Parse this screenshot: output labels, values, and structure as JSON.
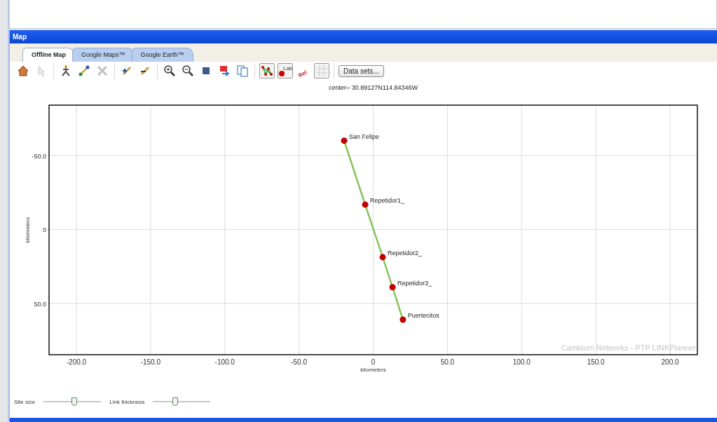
{
  "panel": {
    "title": "Map"
  },
  "tabs": [
    {
      "label": "Offline Map",
      "selected": true
    },
    {
      "label": "Google Maps™",
      "selected": false
    },
    {
      "label": "Google Earth™",
      "selected": false
    }
  ],
  "toolbar": {
    "groups": [
      [
        {
          "kind": "home",
          "pressed": false,
          "disabled": false
        },
        {
          "kind": "pointer",
          "pressed": false,
          "disabled": true
        }
      ],
      [
        {
          "kind": "site",
          "pressed": false,
          "disabled": false
        },
        {
          "kind": "link",
          "pressed": false,
          "disabled": false
        },
        {
          "kind": "delete",
          "pressed": false,
          "disabled": true
        }
      ],
      [
        {
          "kind": "add-brush",
          "pressed": false,
          "disabled": false
        },
        {
          "kind": "remove-brush",
          "pressed": false,
          "disabled": false
        }
      ],
      [
        {
          "kind": "zoom-in",
          "pressed": false,
          "disabled": false
        },
        {
          "kind": "zoom-out",
          "pressed": false,
          "disabled": false
        },
        {
          "kind": "fit",
          "pressed": false,
          "disabled": false
        },
        {
          "kind": "export",
          "pressed": false,
          "disabled": false
        },
        {
          "kind": "copy",
          "pressed": false,
          "disabled": false
        }
      ],
      [
        {
          "kind": "network",
          "pressed": true,
          "disabled": false
        },
        {
          "kind": "label",
          "text": "Lab",
          "pressed": true,
          "disabled": false
        },
        {
          "kind": "relief",
          "text": "Rel",
          "pressed": false,
          "disabled": false
        },
        {
          "kind": "grid",
          "pressed": true,
          "disabled": false
        }
      ]
    ],
    "button": "Data sets..."
  },
  "chart_data": {
    "type": "scatter",
    "title": "center= 30.89127N114.84346W",
    "xlabel": "kilometers",
    "ylabel": "kilometers",
    "x": [
      -19.6,
      -5.4,
      6.4,
      13,
      20
    ],
    "series": [
      {
        "color": "#c00000",
        "values": [
          -60,
          -16.8,
          18.7,
          39,
          60.9
        ]
      }
    ],
    "grid": true,
    "xlim": [
      -218.4,
      218.4
    ],
    "ylim": [
      84.6,
      -84
    ],
    "xticks": [
      {
        "value": -200,
        "label": "-200.0"
      },
      {
        "value": -150,
        "label": "-150.0"
      },
      {
        "value": -100,
        "label": "-100.0"
      },
      {
        "value": -50,
        "label": "-50.0"
      },
      {
        "value": 0,
        "label": "0"
      },
      {
        "value": 50,
        "label": "50.0"
      },
      {
        "value": 100,
        "label": "100.0"
      },
      {
        "value": 150,
        "label": "150.0"
      },
      {
        "value": 200,
        "label": "200.0"
      }
    ],
    "yticks": [
      {
        "value": -50,
        "label": "-50.0"
      },
      {
        "value": 0,
        "label": "0"
      },
      {
        "value": 50,
        "label": "50.0"
      }
    ],
    "annotations": [
      {
        "text": "San Felipe",
        "x": -19.6,
        "y": -60
      },
      {
        "text": "Repetidor1_",
        "x": -5.4,
        "y": -16.8
      },
      {
        "text": "Repetidor2_",
        "x": 6.4,
        "y": 18.7
      },
      {
        "text": "Repetidor3_",
        "x": 13,
        "y": 39
      },
      {
        "text": "Puertecitos",
        "x": 20,
        "y": 60.9
      },
      {
        "text": "Cambium Networks - PTP LINKPlanner"
      }
    ]
  },
  "sliders": [
    {
      "label": "Site size",
      "level": 0.53
    },
    {
      "label": "Link thickness",
      "level": 0.39
    }
  ]
}
